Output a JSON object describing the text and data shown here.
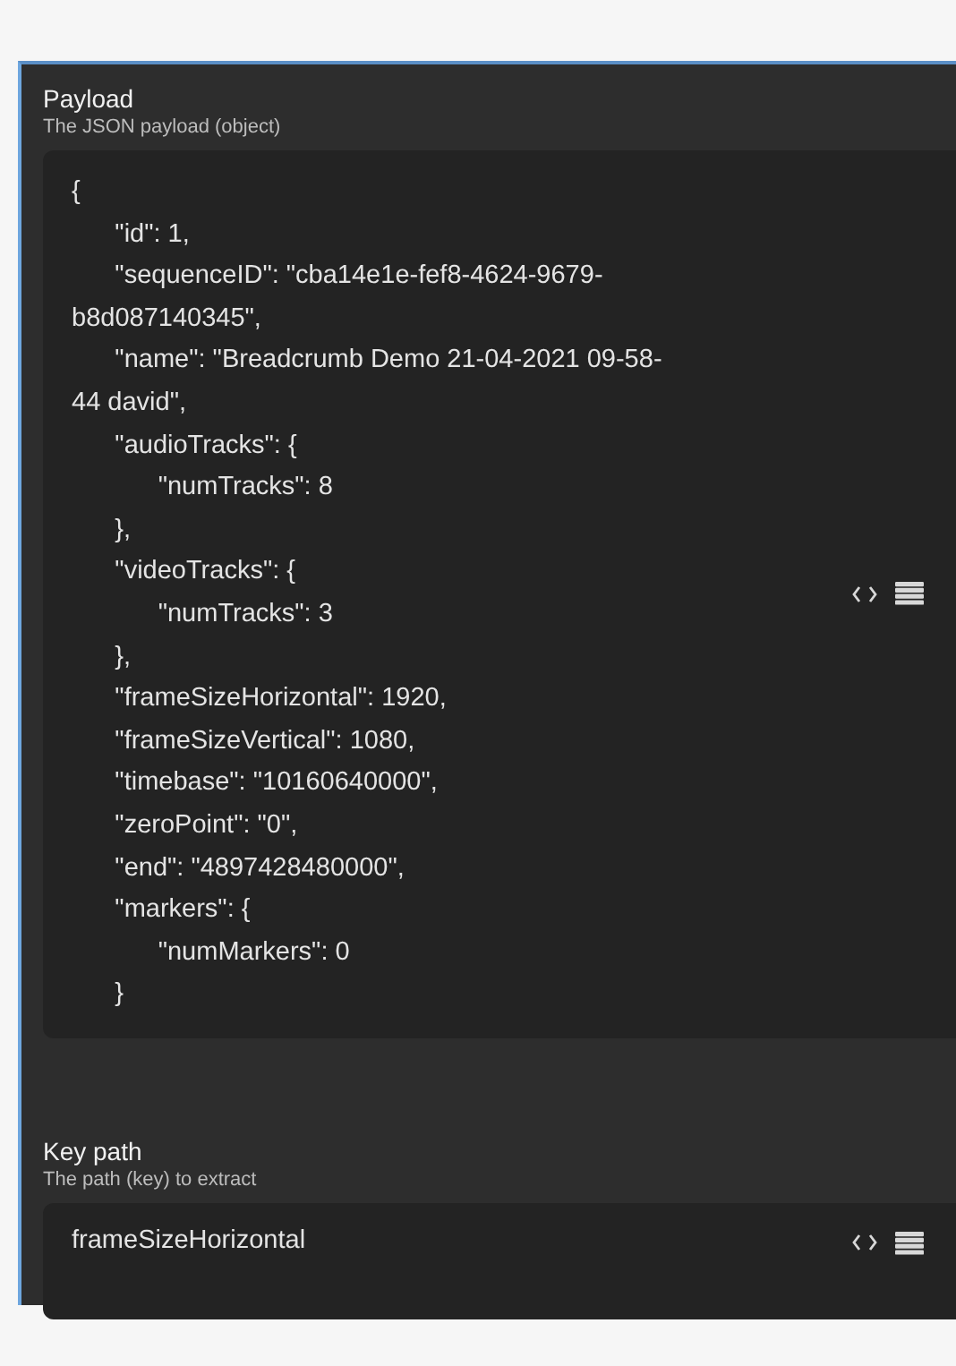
{
  "fields": [
    {
      "label": "Payload",
      "description": "The JSON payload (object)",
      "value_lines": [
        "{",
        "      \"id\": 1,",
        "      \"sequenceID\": \"cba14e1e-fef8-4624-9679-",
        "b8d087140345\",",
        "      \"name\": \"Breadcrumb Demo 21-04-2021 09-58-",
        "44 david\",",
        "      \"audioTracks\": {",
        "            \"numTracks\": 8",
        "      },",
        "      \"videoTracks\": {",
        "            \"numTracks\": 3",
        "      },",
        "      \"frameSizeHorizontal\": 1920,",
        "      \"frameSizeVertical\": 1080,",
        "      \"timebase\": \"10160640000\",",
        "      \"zeroPoint\": \"0\",",
        "      \"end\": \"4897428480000\",",
        "      \"markers\": {",
        "            \"numMarkers\": 0",
        "      }"
      ]
    },
    {
      "label": "Key path",
      "description": "The path (key) to extract",
      "value_lines": [
        "frameSizeHorizontal"
      ]
    }
  ]
}
